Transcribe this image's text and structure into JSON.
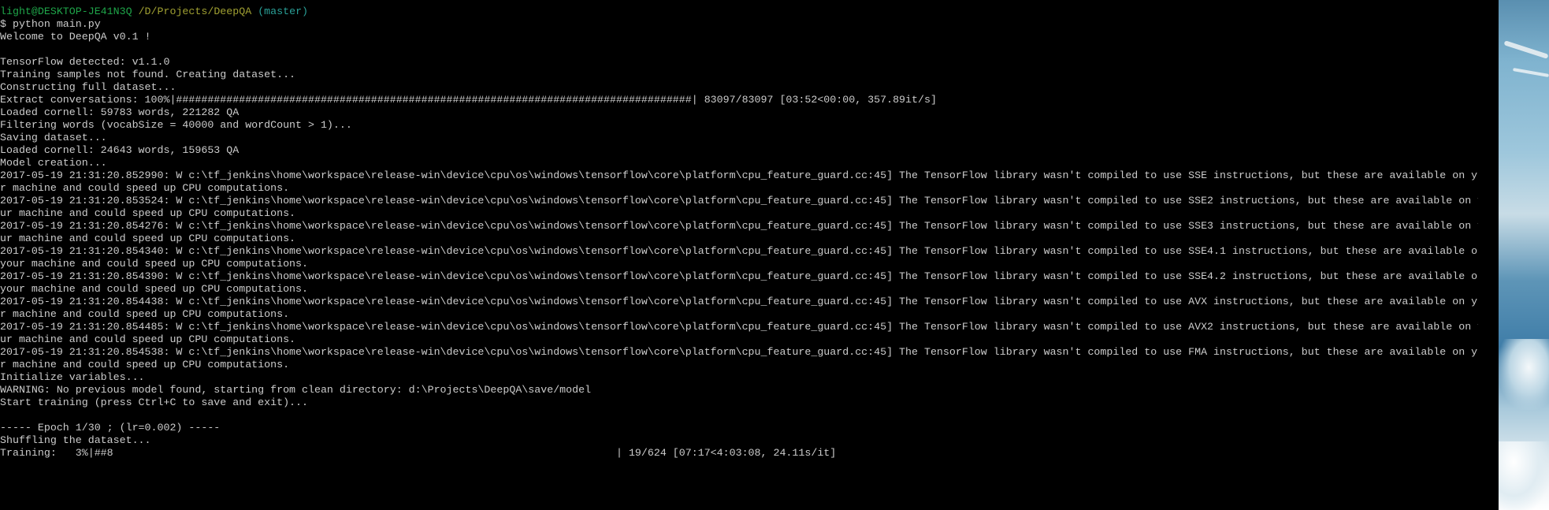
{
  "prompt": {
    "user_host": "light@DESKTOP-JE41N3Q",
    "path": "/D/Projects/DeepQA",
    "branch": "(master)",
    "command": "$ python main.py"
  },
  "output": {
    "welcome": "Welcome to DeepQA v0.1 !",
    "tf_detected": "TensorFlow detected: v1.1.0",
    "samples_not_found": "Training samples not found. Creating dataset...",
    "constructing": "Constructing full dataset...",
    "extract": "Extract conversations: 100%|##################################################################################| 83097/83097 [03:52<00:00, 357.89it/s]",
    "loaded_cornell_1": "Loaded cornell: 59783 words, 221282 QA",
    "filtering": "Filtering words (vocabSize = 40000 and wordCount > 1)...",
    "saving": "Saving dataset...",
    "loaded_cornell_2": "Loaded cornell: 24643 words, 159653 QA",
    "model_creation": "Model creation...",
    "warnings": [
      {
        "a": "2017-05-19 21:31:20.852990: W c:\\tf_jenkins\\home\\workspace\\release-win\\device\\cpu\\os\\windows\\tensorflow\\core\\platform\\cpu_feature_guard.cc:45] The TensorFlow library wasn't compiled to use SSE instructions, but these are available on you",
        "b": "r machine and could speed up CPU computations."
      },
      {
        "a": "2017-05-19 21:31:20.853524: W c:\\tf_jenkins\\home\\workspace\\release-win\\device\\cpu\\os\\windows\\tensorflow\\core\\platform\\cpu_feature_guard.cc:45] The TensorFlow library wasn't compiled to use SSE2 instructions, but these are available on yo",
        "b": "ur machine and could speed up CPU computations."
      },
      {
        "a": "2017-05-19 21:31:20.854276: W c:\\tf_jenkins\\home\\workspace\\release-win\\device\\cpu\\os\\windows\\tensorflow\\core\\platform\\cpu_feature_guard.cc:45] The TensorFlow library wasn't compiled to use SSE3 instructions, but these are available on yo",
        "b": "ur machine and could speed up CPU computations."
      },
      {
        "a": "2017-05-19 21:31:20.854340: W c:\\tf_jenkins\\home\\workspace\\release-win\\device\\cpu\\os\\windows\\tensorflow\\core\\platform\\cpu_feature_guard.cc:45] The TensorFlow library wasn't compiled to use SSE4.1 instructions, but these are available on",
        "b": "your machine and could speed up CPU computations."
      },
      {
        "a": "2017-05-19 21:31:20.854390: W c:\\tf_jenkins\\home\\workspace\\release-win\\device\\cpu\\os\\windows\\tensorflow\\core\\platform\\cpu_feature_guard.cc:45] The TensorFlow library wasn't compiled to use SSE4.2 instructions, but these are available on",
        "b": "your machine and could speed up CPU computations."
      },
      {
        "a": "2017-05-19 21:31:20.854438: W c:\\tf_jenkins\\home\\workspace\\release-win\\device\\cpu\\os\\windows\\tensorflow\\core\\platform\\cpu_feature_guard.cc:45] The TensorFlow library wasn't compiled to use AVX instructions, but these are available on you",
        "b": "r machine and could speed up CPU computations."
      },
      {
        "a": "2017-05-19 21:31:20.854485: W c:\\tf_jenkins\\home\\workspace\\release-win\\device\\cpu\\os\\windows\\tensorflow\\core\\platform\\cpu_feature_guard.cc:45] The TensorFlow library wasn't compiled to use AVX2 instructions, but these are available on yo",
        "b": "ur machine and could speed up CPU computations."
      },
      {
        "a": "2017-05-19 21:31:20.854538: W c:\\tf_jenkins\\home\\workspace\\release-win\\device\\cpu\\os\\windows\\tensorflow\\core\\platform\\cpu_feature_guard.cc:45] The TensorFlow library wasn't compiled to use FMA instructions, but these are available on you",
        "b": "r machine and could speed up CPU computations."
      }
    ],
    "init_vars": "Initialize variables...",
    "warning_no_model": "WARNING: No previous model found, starting from clean directory: d:\\Projects\\DeepQA\\save/model",
    "start_training": "Start training (press Ctrl+C to save and exit)...",
    "epoch": "----- Epoch 1/30 ; (lr=0.002) -----",
    "shuffling": "Shuffling the dataset...",
    "training": "Training:   3%|##8                                                                                | 19/624 [07:17<4:03:08, 24.11s/it]"
  },
  "colors": {
    "background": "#000000",
    "text": "#cccccc",
    "prompt_user": "#1fa64a",
    "prompt_path": "#a0a032",
    "prompt_branch": "#2aa198"
  }
}
